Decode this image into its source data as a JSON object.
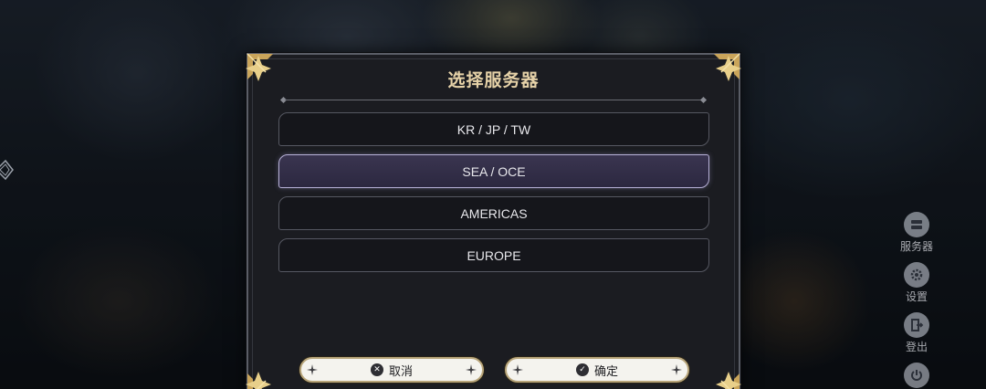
{
  "dialog": {
    "title": "选择服务器",
    "servers": [
      {
        "label": "KR / JP / TW",
        "selected": false
      },
      {
        "label": "SEA / OCE",
        "selected": true
      },
      {
        "label": "AMERICAS",
        "selected": false
      },
      {
        "label": "EUROPE",
        "selected": false
      }
    ],
    "cancel_label": "取消",
    "confirm_label": "确定"
  },
  "side_menu": {
    "items": [
      {
        "label": "服务器",
        "icon": "server-icon"
      },
      {
        "label": "设置",
        "icon": "gear-icon"
      },
      {
        "label": "登出",
        "icon": "logout-icon"
      },
      {
        "label": "",
        "icon": "power-icon"
      }
    ]
  },
  "colors": {
    "accent_gold": "#e6d2a8",
    "selected_bg": "#3a3550",
    "selected_border": "#b8b2d8"
  }
}
